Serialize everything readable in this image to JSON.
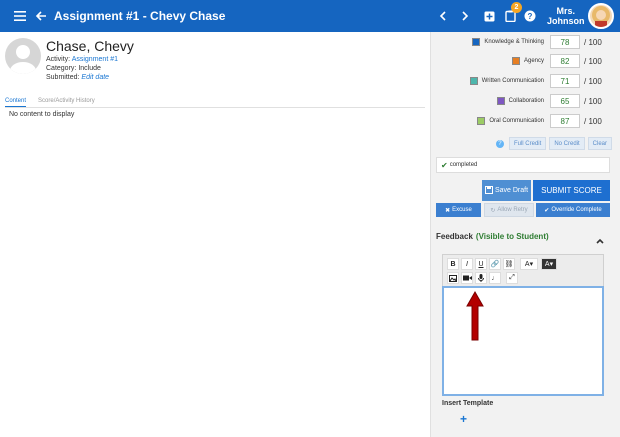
{
  "header": {
    "title": "Assignment #1 - Chevy Chase",
    "user_line1": "Mrs.",
    "user_line2": "Johnson",
    "notification_count": "2",
    "icons": [
      "menu-icon",
      "back-arrow-icon",
      "chevron-left-icon",
      "chevron-right-icon",
      "plus-box-icon",
      "clipboard-icon",
      "help-icon"
    ]
  },
  "student": {
    "name": "Chase, Chevy",
    "activity_label": "Activity:",
    "activity_value": "Assignment #1",
    "category_label": "Category:",
    "category_value": "Include",
    "submitted_label": "Submitted:",
    "submitted_value": "Edit date"
  },
  "tabs": [
    "Content",
    "Score/Activity History"
  ],
  "content": {
    "empty_text": "No content to display"
  },
  "rubric": [
    {
      "label": "Knowledge & Thinking",
      "score": "78",
      "max": "/ 100",
      "color": "#1565c0"
    },
    {
      "label": "Agency",
      "score": "82",
      "max": "/ 100",
      "color": "#e67e22"
    },
    {
      "label": "Written Communication",
      "score": "71",
      "max": "/ 100",
      "color": "#4db6ac"
    },
    {
      "label": "Collaboration",
      "score": "65",
      "max": "/ 100",
      "color": "#7e57c2"
    },
    {
      "label": "Oral Communication",
      "score": "87",
      "max": "/ 100",
      "color": "#9ccc65"
    }
  ],
  "credit_buttons": {
    "full": "Full Credit",
    "none": "No Credit",
    "clear": "Clear"
  },
  "status": {
    "text": "completed"
  },
  "actions": {
    "save_draft": "Save Draft",
    "submit_score": "SUBMIT SCORE",
    "excuse": "Excuse",
    "allow_retry": "Allow Retry",
    "override": "Override Complete"
  },
  "feedback": {
    "title": "Feedback",
    "visibility": "(Visible to Student)",
    "insert_template": "Insert Template"
  },
  "toolbar": {
    "bold": "B",
    "italic": "I",
    "underline": "U",
    "text_color": "A",
    "bg_color": "A"
  }
}
